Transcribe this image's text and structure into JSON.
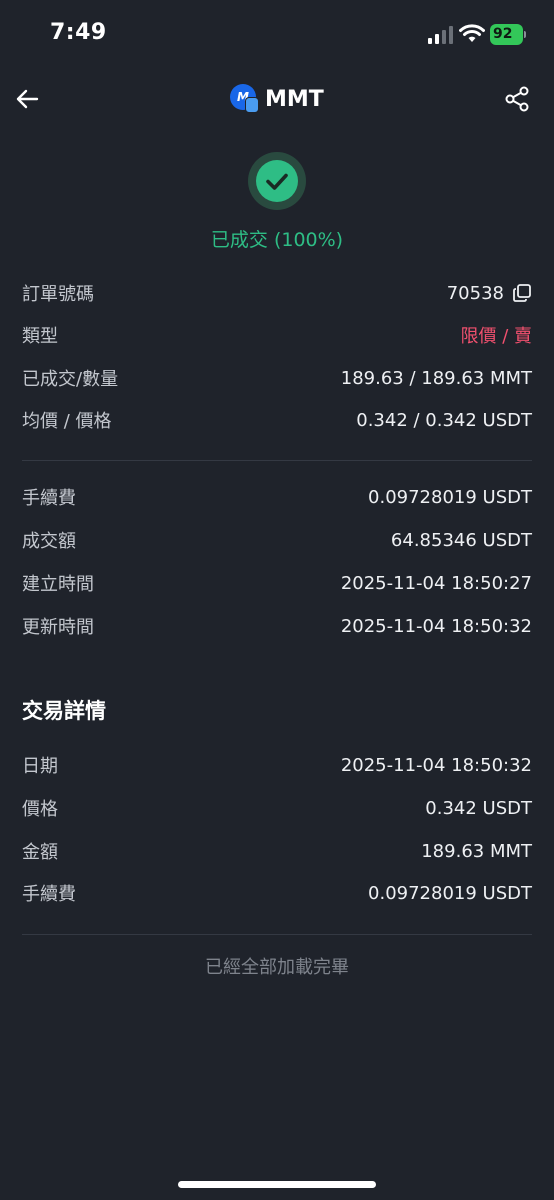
{
  "status_bar": {
    "time": "7:49",
    "battery": "92"
  },
  "header": {
    "title": "MMT",
    "coin_logo_text": "M",
    "back_icon": "arrow-left-icon",
    "share_icon": "share-icon"
  },
  "order": {
    "status_text": "已成交 (100%)",
    "status_color": "#2ebd85"
  },
  "order_info": [
    {
      "label": "訂單號碼",
      "value": "70538"
    },
    {
      "label": "類型",
      "value": "限價 / 賣"
    },
    {
      "label": "已成交/數量",
      "value": "189.63 / 189.63 MMT"
    },
    {
      "label": "均價 / 價格",
      "value": "0.342 / 0.342 USDT"
    }
  ],
  "fee_info": [
    {
      "label": "手續費",
      "value": "0.09728019 USDT"
    },
    {
      "label": "成交額",
      "value": "64.85346 USDT"
    },
    {
      "label": "建立時間",
      "value": "2025-11-04 18:50:27"
    },
    {
      "label": "更新時間",
      "value": "2025-11-04 18:50:32"
    }
  ],
  "trade_details": {
    "title": "交易詳情",
    "rows": [
      {
        "label": "日期",
        "value": "2025-11-04 18:50:32"
      },
      {
        "label": "價格",
        "value": "0.342 USDT"
      },
      {
        "label": "金額",
        "value": "189.63 MMT"
      },
      {
        "label": "手續費",
        "value": "0.09728019 USDT"
      }
    ]
  },
  "footer": {
    "note": "已經全部加載完畢"
  },
  "colors": {
    "background": "#1f232b",
    "success": "#2ebd85",
    "sell": "#f0506e"
  }
}
